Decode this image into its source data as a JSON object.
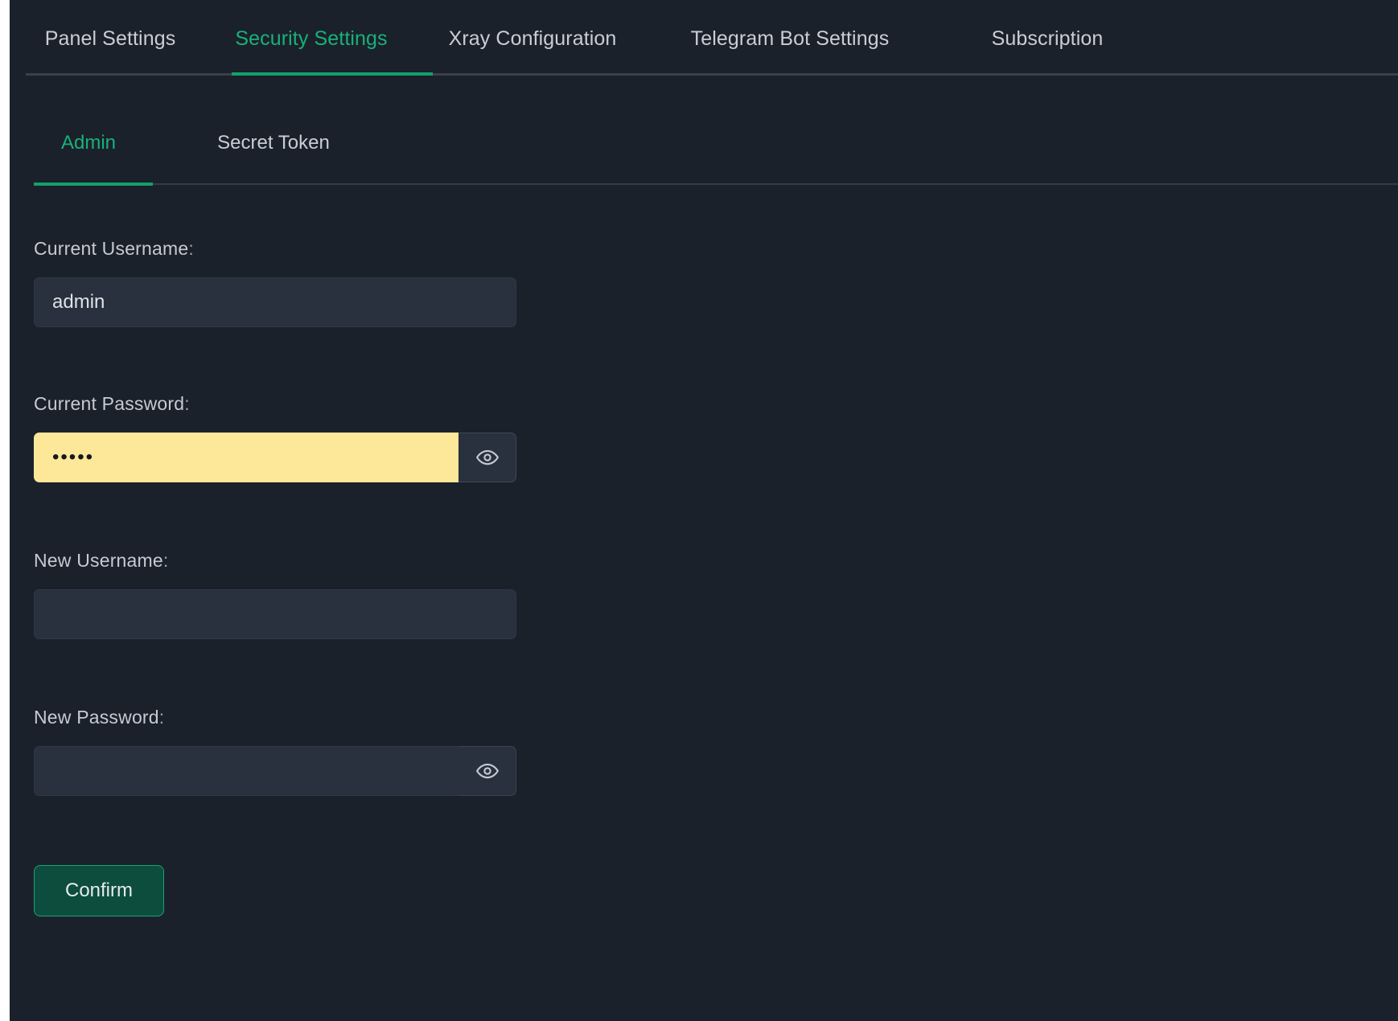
{
  "theme": {
    "background": "#1b212a",
    "accent": "#12a06a",
    "accent_text": "#19b07a",
    "input_background": "#28313d",
    "autofill_background": "#fde799",
    "text": "#c9ced5",
    "muted_text": "#9aa2ac",
    "divider": "#39414d",
    "confirm_fill": "#0d4d3e",
    "confirm_border": "#18a371"
  },
  "main_tabs": {
    "active": "Security Settings",
    "items": [
      {
        "label": "Panel Settings",
        "active": false
      },
      {
        "label": "Security Settings",
        "active": true
      },
      {
        "label": "Xray Configuration",
        "active": false
      },
      {
        "label": "Telegram Bot Settings",
        "active": false
      },
      {
        "label": "Subscription",
        "active": false
      }
    ]
  },
  "sub_tabs": {
    "active": "Admin",
    "items": [
      {
        "label": "Admin",
        "active": true
      },
      {
        "label": "Secret Token",
        "active": false
      }
    ]
  },
  "form": {
    "current_username": {
      "label": "Current Username",
      "colon": ":",
      "value": "admin",
      "placeholder": ""
    },
    "current_password": {
      "label": "Current Password",
      "colon": ":",
      "value": "•••••",
      "masked_char_count": 5,
      "placeholder": "",
      "autofilled": true,
      "toggle_icon": "eye-icon"
    },
    "new_username": {
      "label": "New Username",
      "colon": ":",
      "value": "",
      "placeholder": ""
    },
    "new_password": {
      "label": "New Password",
      "colon": ":",
      "value": "",
      "placeholder": "",
      "autofilled": false,
      "toggle_icon": "eye-icon"
    },
    "confirm_button": {
      "label": "Confirm"
    }
  }
}
